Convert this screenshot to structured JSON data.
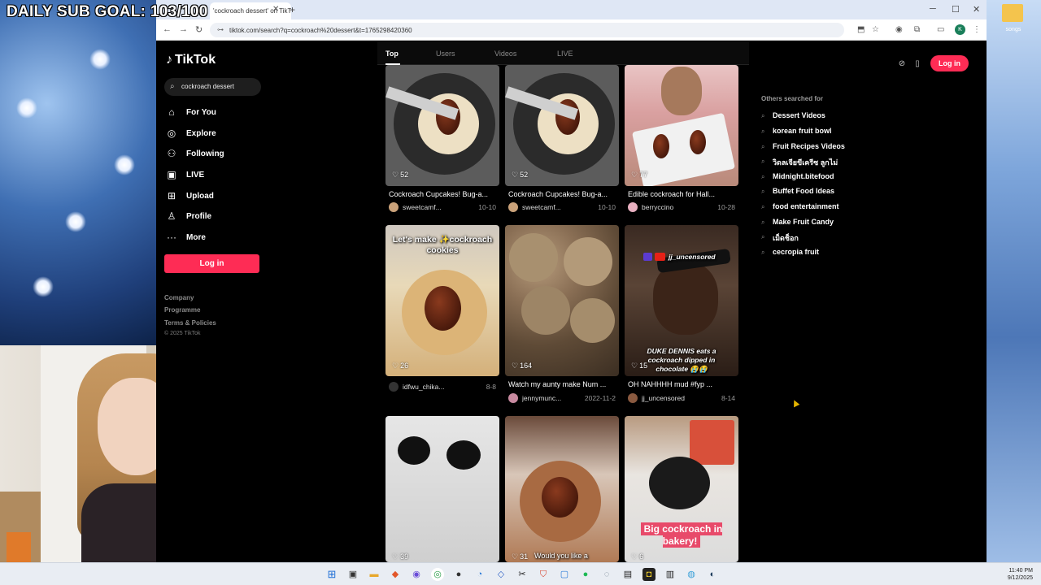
{
  "overlay": {
    "sub_goal": "DAILY SUB GOAL: 103/100"
  },
  "desktop": {
    "folder_label": "songs"
  },
  "browser": {
    "tab_title": "'cockroach dessert' on TikTok",
    "url": "tiktok.com/search?q=cockroach%20dessert&t=1765298420360",
    "profile_initial": "K"
  },
  "tiktok": {
    "logo": "TikTok",
    "search_value": "cockroach dessert",
    "nav": [
      {
        "label": "For You",
        "icon": "home-icon"
      },
      {
        "label": "Explore",
        "icon": "compass-icon"
      },
      {
        "label": "Following",
        "icon": "following-icon"
      },
      {
        "label": "LIVE",
        "icon": "live-icon"
      },
      {
        "label": "Upload",
        "icon": "upload-icon"
      },
      {
        "label": "Profile",
        "icon": "profile-icon"
      },
      {
        "label": "More",
        "icon": "more-icon"
      }
    ],
    "login_label": "Log in",
    "footer": {
      "company": "Company",
      "programme": "Programme",
      "terms": "Terms & Policies",
      "copyright": "© 2025 TikTok"
    },
    "tabs": [
      "Top",
      "Users",
      "Videos",
      "LIVE"
    ],
    "others_header": "Others searched for",
    "suggestions": [
      "Dessert Videos",
      "korean fruit bowl",
      "Fruit Recipes Videos",
      "วิดลเจียขีเครีซ ลูกไม่",
      "Midnight.bitefood",
      "Buffet Food Ideas",
      "food entertainment",
      "Make Fruit Candy",
      "เม็ดช็อก",
      "cecropia fruit"
    ],
    "videos": [
      {
        "likes": "52",
        "title": "Cockroach Cupcakes! Bug-a...",
        "user": "sweetcamf...",
        "date": "10-10",
        "overlay": ""
      },
      {
        "likes": "52",
        "title": "Cockroach Cupcakes! Bug-a...",
        "user": "sweetcamf...",
        "date": "10-10",
        "overlay": ""
      },
      {
        "likes": "77",
        "title": "Edible cockroach for Hall...",
        "user": "berryccino",
        "date": "10-28",
        "overlay": ""
      },
      {
        "likes": "26",
        "title": "",
        "user": "idfwu_chika...",
        "date": "8-8",
        "overlay": "Let's make ✨cockroach cookies"
      },
      {
        "likes": "164",
        "title": "Watch my aunty make Num ...",
        "user": "jennymunc...",
        "date": "2022-11-2",
        "overlay": ""
      },
      {
        "likes": "15",
        "title": "OH NAHHHH mud #fyp ...",
        "user": "jj_uncensored",
        "date": "8-14",
        "overlay": "DUKE DENNIS eats a cockroach dipped in chocolate 😭😭",
        "top_tag": "jj_uncensored"
      },
      {
        "likes": "39",
        "title": "",
        "user": "",
        "date": "",
        "overlay": ""
      },
      {
        "likes": "31",
        "title": "",
        "user": "",
        "date": "",
        "overlay": "Would you like a"
      },
      {
        "likes": "6",
        "title": "",
        "user": "",
        "date": "",
        "overlay": "Big cockroach in bakery!"
      }
    ]
  },
  "taskbar": {
    "time": "11:40 PM",
    "date": "9/12/2025"
  },
  "colors": {
    "accent": "#fe2c55",
    "page_bg": "#000000"
  }
}
